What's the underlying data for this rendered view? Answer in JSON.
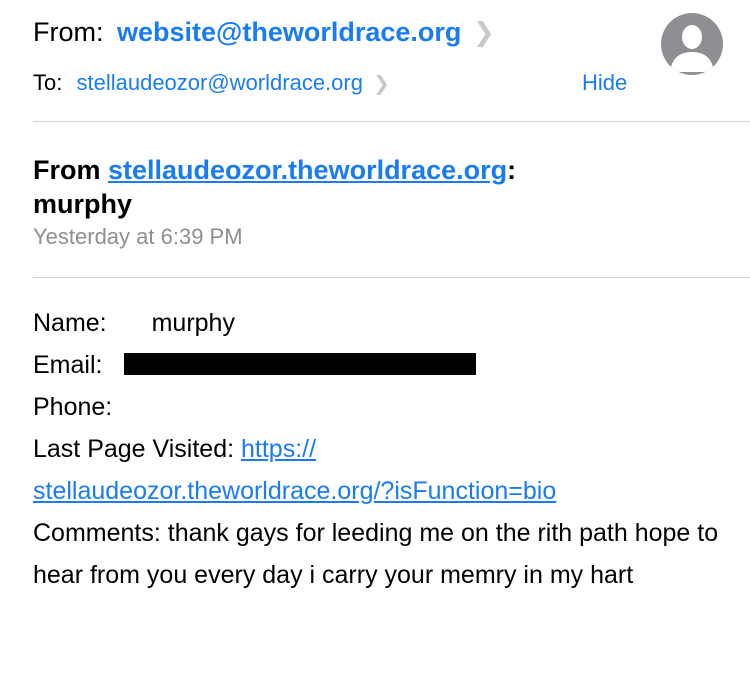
{
  "header": {
    "from_label": "From:",
    "from_value": "website@theworldrace.org",
    "to_label": "To:",
    "to_value": "stellaudeozor@worldrace.org",
    "hide_label": "Hide",
    "chevron_icon": "chevron-right-icon",
    "avatar_icon": "person-silhouette-icon"
  },
  "message": {
    "subject_prefix": "From ",
    "subject_link": "stellaudeozor.theworldrace.org",
    "subject_colon": ":",
    "subject_name": "murphy",
    "timestamp": "Yesterday at 6:39 PM"
  },
  "body": {
    "name_label": "Name:",
    "name_value": "murphy",
    "email_label": "Email:",
    "phone_label": "Phone:",
    "last_page_label": "Last Page Visited: ",
    "last_page_link_line1": "https://",
    "last_page_link_line2": "stellaudeozor.theworldrace.org/?isFunction=bio",
    "comments_label": "Comments: ",
    "comments_text": "thank gays for leeding me on the rith path hope to hear from you every day i carry your memry in my hart"
  },
  "colors": {
    "accent": "#1a7cf5",
    "secondary_text": "#8e8e93",
    "divider": "#d1d1d6",
    "redaction": "#000000"
  }
}
